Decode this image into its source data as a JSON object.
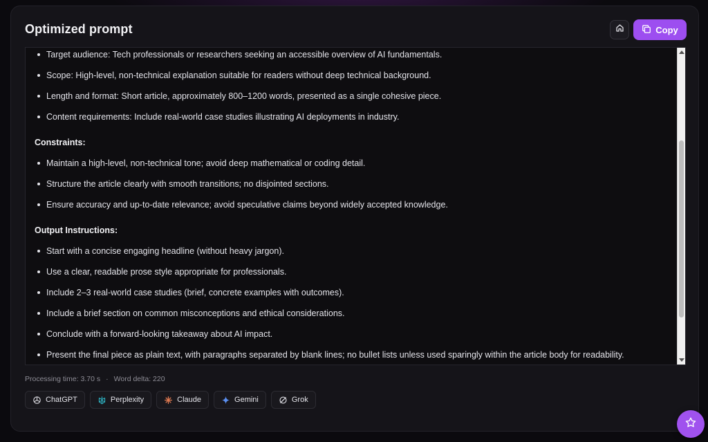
{
  "header": {
    "title": "Optimized prompt",
    "copy_label": "Copy"
  },
  "content": {
    "intro_items": [
      "Target audience: Tech professionals or researchers seeking an accessible overview of AI fundamentals.",
      "Scope: High-level, non-technical explanation suitable for readers without deep technical background.",
      "Length and format: Short article, approximately 800–1200 words, presented as a single cohesive piece.",
      "Content requirements: Include real-world case studies illustrating AI deployments in industry."
    ],
    "constraints_heading": "Constraints:",
    "constraints": [
      "Maintain a high-level, non-technical tone; avoid deep mathematical or coding detail.",
      "Structure the article clearly with smooth transitions; no disjointed sections.",
      "Ensure accuracy and up-to-date relevance; avoid speculative claims beyond widely accepted knowledge."
    ],
    "output_heading": "Output Instructions:",
    "output": [
      "Start with a concise engaging headline (without heavy jargon).",
      "Use a clear, readable prose style appropriate for professionals.",
      "Include 2–3 real-world case studies (brief, concrete examples with outcomes).",
      "Include a brief section on common misconceptions and ethical considerations.",
      "Conclude with a forward-looking takeaway about AI impact.",
      "Present the final piece as plain text, with paragraphs separated by blank lines; no bullet lists unless used sparingly within the article body for readability."
    ]
  },
  "meta": {
    "processing_time": "Processing time: 3.70 s",
    "separator": "·",
    "word_delta": "Word delta: 220"
  },
  "models": [
    {
      "label": "ChatGPT",
      "icon": "chatgpt-icon"
    },
    {
      "label": "Perplexity",
      "icon": "perplexity-icon"
    },
    {
      "label": "Claude",
      "icon": "claude-icon"
    },
    {
      "label": "Gemini",
      "icon": "gemini-icon"
    },
    {
      "label": "Grok",
      "icon": "grok-icon"
    }
  ],
  "colors": {
    "accent": "#9d4ef0",
    "background": "#0b0a0e",
    "card": "#151419"
  }
}
